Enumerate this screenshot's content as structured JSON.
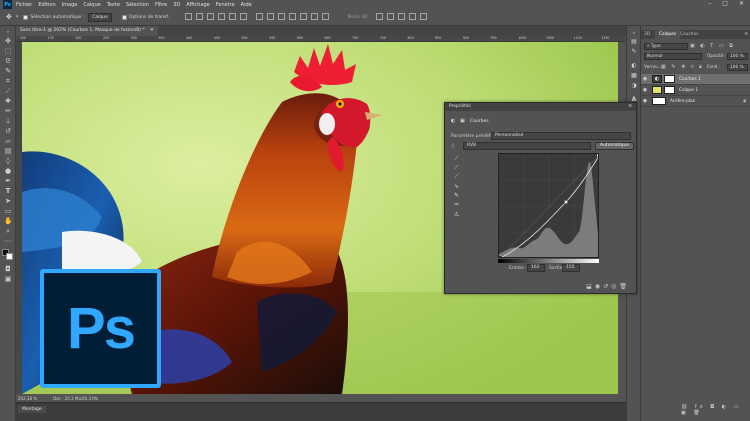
{
  "menu": [
    "Fichier",
    "Edition",
    "Image",
    "Calque",
    "Texte",
    "Sélection",
    "Filtre",
    "3D",
    "Affichage",
    "Fenêtre",
    "Aide"
  ],
  "app_logo": "Ps",
  "options": {
    "auto_select_label": "Sélection automatique :",
    "auto_select_value": "Calque",
    "transform_label": "Options de transf.",
    "mode_3d_label": "Mode 3D :"
  },
  "document": {
    "tab_title": "Sans titre-1 @ 202% (Courbes 1, Masque de fusion/8) *",
    "zoom": "202,38 %",
    "doc_info": "Doc : 20,3 Mo/20,3 Mo",
    "ruler_marks": [
      "100",
      "150",
      "200",
      "250",
      "300",
      "350",
      "400",
      "450",
      "500",
      "550",
      "600",
      "650",
      "700",
      "750",
      "800",
      "850",
      "900",
      "950",
      "1000",
      "1050",
      "1100",
      "1150"
    ]
  },
  "workspace_tab": "Montage",
  "layers_panel": {
    "tabs": [
      "3D",
      "Calques",
      "Couches"
    ],
    "kind_filter": "Type",
    "blend_mode": "Normal",
    "opacity_label": "Opacité :",
    "opacity_value": "100 %",
    "lock_label": "Verrou :",
    "fill_label": "Fond :",
    "fill_value": "100 %",
    "layers": [
      {
        "name": "Courbes 1"
      },
      {
        "name": "Calque 1"
      },
      {
        "name": "Arrière-plan"
      }
    ]
  },
  "properties_panel": {
    "title": "Propriétés",
    "header": "Courbes",
    "preset_label": "Paramètre prédéfini :",
    "preset_value": "Personnalisé",
    "channel_value": "RVB",
    "auto_button": "Automatique",
    "input_label": "Entrée :",
    "input_value": "162",
    "output_label": "Sortie :",
    "output_value": "155"
  },
  "colors": {
    "ps_blue": "#31a8ff",
    "ps_dark": "#001e36",
    "panel": "#535353"
  }
}
